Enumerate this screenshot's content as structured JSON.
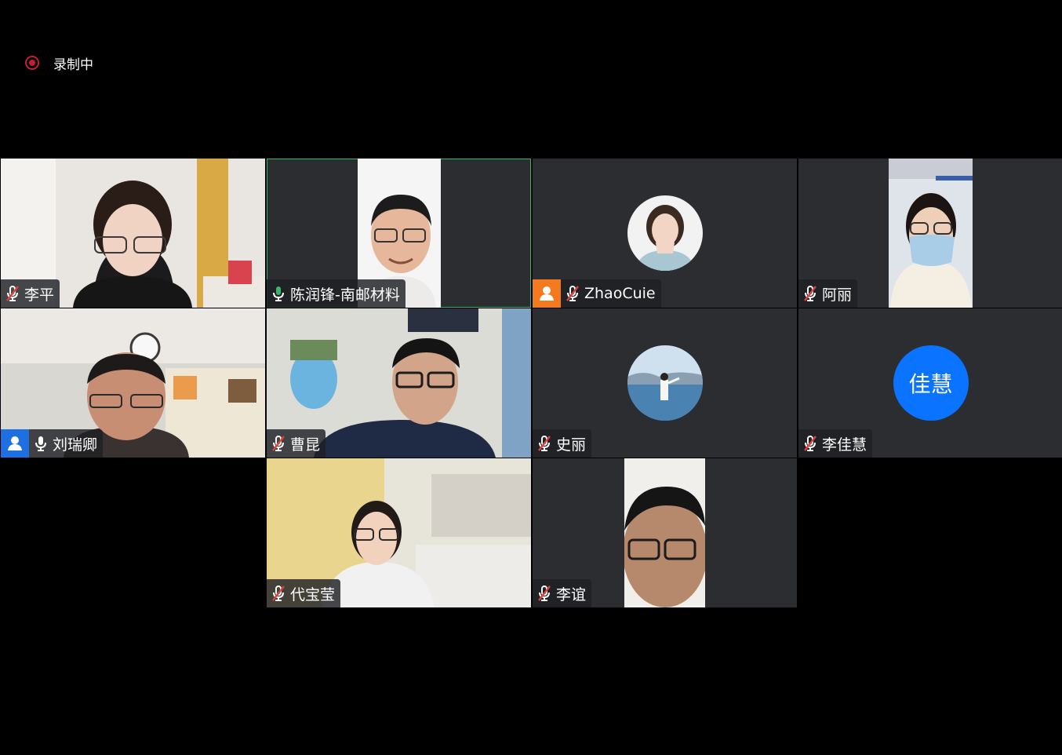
{
  "recording": {
    "label": "录制中",
    "icon": "record-icon",
    "color": "#c42027"
  },
  "participants": [
    {
      "name": "李平",
      "mic": "muted"
    },
    {
      "name": "陈润锋-南邮材料",
      "mic": "speaking",
      "active": true
    },
    {
      "name": "ZhaoCuie",
      "mic": "muted",
      "badge": "host",
      "avatar": "photo"
    },
    {
      "name": "阿丽",
      "mic": "muted"
    },
    {
      "name": "刘瑞卿",
      "mic": "on",
      "badge": "cohost"
    },
    {
      "name": "曹昆",
      "mic": "muted"
    },
    {
      "name": "史丽",
      "mic": "muted",
      "avatar": "photo"
    },
    {
      "name": "李佳慧",
      "mic": "muted",
      "avatar": "initials",
      "initials": "佳慧"
    },
    {
      "name": "代宝莹",
      "mic": "muted"
    },
    {
      "name": "李谊",
      "mic": "muted"
    }
  ],
  "colors": {
    "accent": "#0a73ff",
    "speaking": "#3fb36b",
    "muted": "#e0413b",
    "host_badge": "#f47a1f",
    "cohost_badge": "#1e6fe0"
  }
}
